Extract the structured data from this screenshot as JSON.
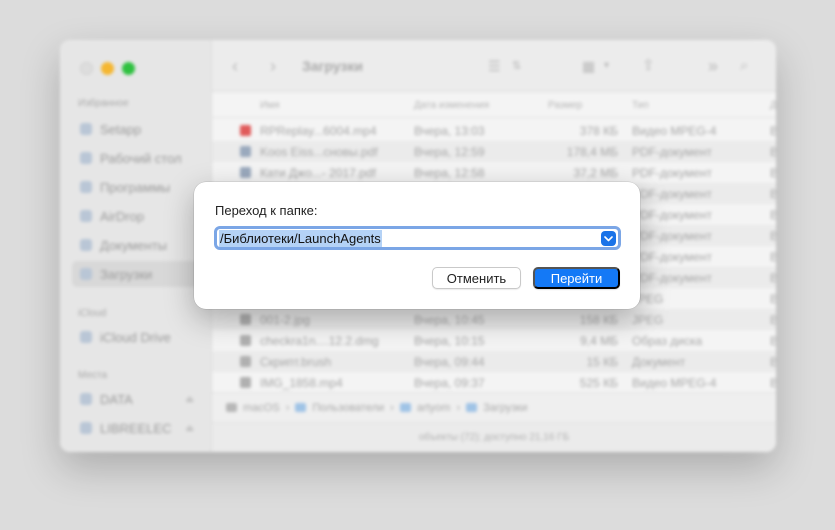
{
  "finder": {
    "title": "Загрузки",
    "sidebar": {
      "favorites_heading": "Избранное",
      "favorites": [
        "Setapp",
        "Рабочий стол",
        "Программы",
        "AirDrop",
        "Документы",
        "Загрузки"
      ],
      "icloud_heading": "iCloud",
      "icloud": [
        "iCloud Drive"
      ],
      "locations_heading": "Места",
      "locations": [
        "DATA",
        "LIBREELEC"
      ]
    },
    "columns": [
      "Имя",
      "Дата изменения",
      "Размер",
      "Тип",
      "Д"
    ],
    "rows": [
      {
        "name": "RPReplay...6004.mp4",
        "date": "Вчера, 13:03",
        "size": "378 КБ",
        "kind": "Видео MPEG-4",
        "extra": "В"
      },
      {
        "name": "Koos Eiss...сновы.pdf",
        "date": "Вчера, 12:59",
        "size": "178,4 МБ",
        "kind": "PDF-документ",
        "extra": "В"
      },
      {
        "name": "Кати Джо...- 2017.pdf",
        "date": "Вчера, 12:58",
        "size": "37,2 МБ",
        "kind": "PDF-документ",
        "extra": "В"
      },
      {
        "name": "",
        "date": "",
        "size": "",
        "kind": "PDF-документ",
        "extra": "В"
      },
      {
        "name": "",
        "date": "",
        "size": "",
        "kind": "PDF-документ",
        "extra": "В"
      },
      {
        "name": "",
        "date": "",
        "size": "",
        "kind": "PDF-документ",
        "extra": "В"
      },
      {
        "name": "",
        "date": "",
        "size": "",
        "kind": "PDF-документ",
        "extra": "В"
      },
      {
        "name": "",
        "date": "",
        "size": "",
        "kind": "PDF-документ",
        "extra": "В"
      },
      {
        "name": "",
        "date": "",
        "size": "",
        "kind": "JPEG",
        "extra": "В"
      },
      {
        "name": "001-2.jpg",
        "date": "Вчера, 10:45",
        "size": "158 КБ",
        "kind": "JPEG",
        "extra": "В"
      },
      {
        "name": "checkra1n....12.2.dmg",
        "date": "Вчера, 10:15",
        "size": "9,4 МБ",
        "kind": "Образ диска",
        "extra": "В"
      },
      {
        "name": "Скрипт.brush",
        "date": "Вчера, 09:44",
        "size": "15 КБ",
        "kind": "Документ",
        "extra": "В"
      },
      {
        "name": "IMG_1858.mp4",
        "date": "Вчера, 09:37",
        "size": "525 КБ",
        "kind": "Видео MPEG-4",
        "extra": "В"
      }
    ],
    "path": [
      "macOS",
      "Пользователи",
      "artyom",
      "Загрузки"
    ],
    "status": "объекты (72); доступно 21,16 ГБ"
  },
  "dialog": {
    "title": "Переход к папке:",
    "path_value": "/Библиотеки/LaunchAgents",
    "cancel_label": "Отменить",
    "go_label": "Перейти"
  },
  "colors": {
    "accent": "#1479f6",
    "selection": "#b4d2f6",
    "focus_ring": "#7ba6e6"
  }
}
